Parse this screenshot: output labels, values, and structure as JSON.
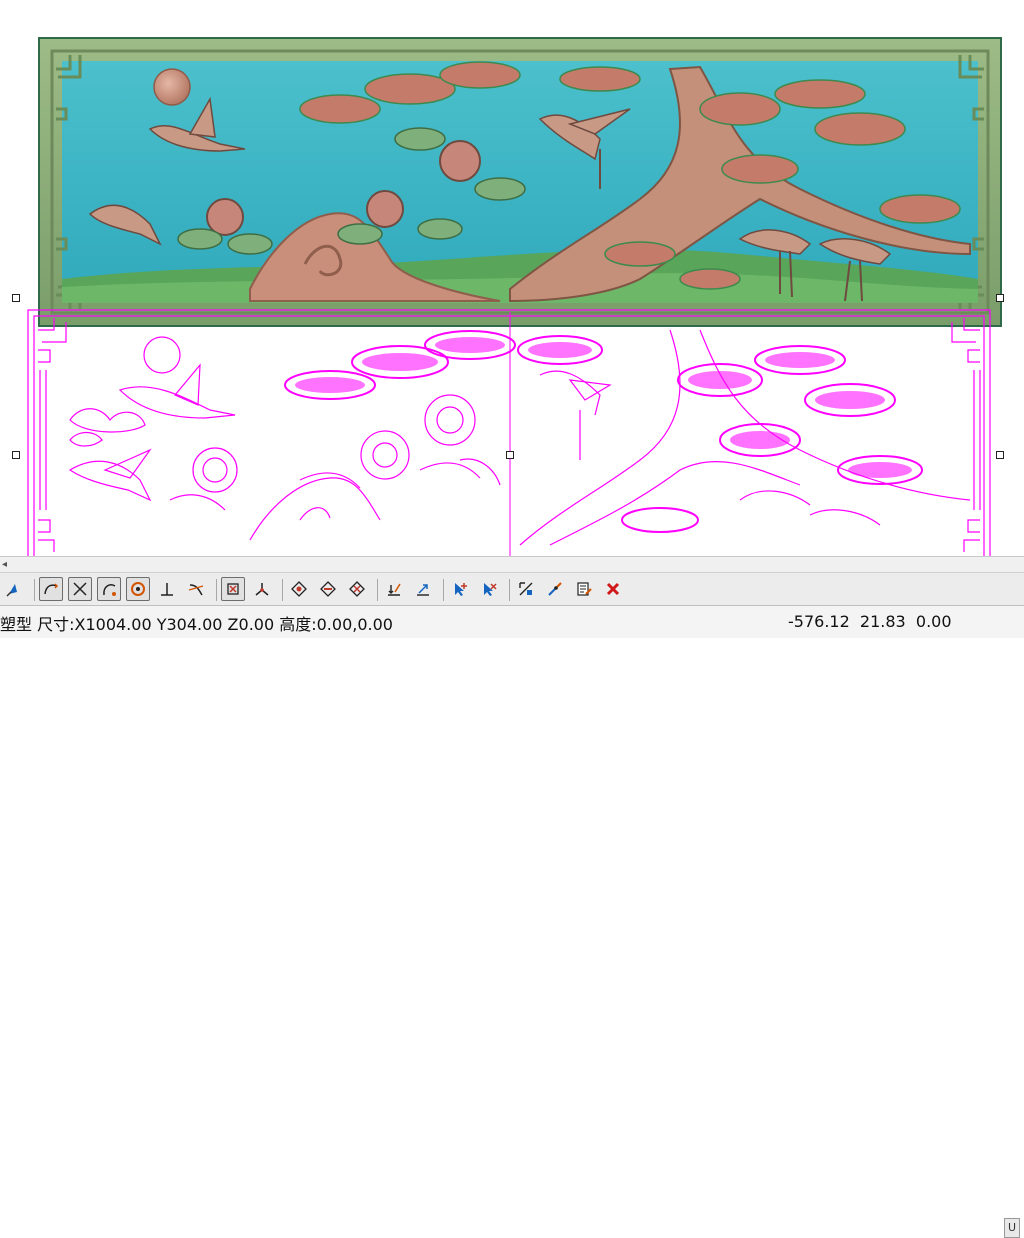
{
  "status": {
    "prefix": "塑型",
    "text": "尺寸:X1004.00 Y304.00 Z0.00 高度:0.00,0.00",
    "coords": "-576.12  21.83  0.00"
  },
  "toolbar": {
    "buttons": [
      {
        "name": "arrow-tool-icon",
        "group": 0
      },
      {
        "name": "curve-tool-icon",
        "group": 1,
        "pressed": true
      },
      {
        "name": "cross-tool-icon",
        "group": 1,
        "pressed": true
      },
      {
        "name": "arc-tool-icon",
        "group": 1,
        "pressed": true
      },
      {
        "name": "circle-target-icon",
        "group": 1,
        "pressed": true
      },
      {
        "name": "perpendicular-icon",
        "group": 1
      },
      {
        "name": "tangent-icon",
        "group": 1
      },
      {
        "name": "node-snap-icon",
        "group": 2,
        "pressed": true
      },
      {
        "name": "axis-snap-icon",
        "group": 2
      },
      {
        "name": "diamond-add-icon",
        "group": 3
      },
      {
        "name": "diamond-remove-icon",
        "group": 3
      },
      {
        "name": "diamond-cross-icon",
        "group": 3
      },
      {
        "name": "layer-down-icon",
        "group": 4
      },
      {
        "name": "layer-up-icon",
        "group": 4
      },
      {
        "name": "select-add-icon",
        "group": 5
      },
      {
        "name": "select-remove-icon",
        "group": 5
      },
      {
        "name": "transform-icon",
        "group": 6
      },
      {
        "name": "edit-node-icon",
        "group": 6
      },
      {
        "name": "list-edit-icon",
        "group": 6
      },
      {
        "name": "delete-icon",
        "group": 6
      }
    ]
  },
  "colors": {
    "relief_sky": "#3fb6c4",
    "relief_frame": "#8fb07a",
    "relief_border": "#2e6b4a",
    "relief_ground": "#5aa659",
    "vector_line": "#ff00ff",
    "delete": "#d01818"
  }
}
